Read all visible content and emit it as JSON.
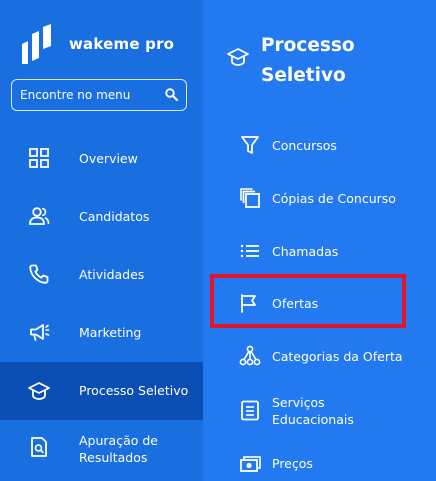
{
  "brand": {
    "name": "wakeme pro"
  },
  "search": {
    "placeholder": "Encontre no menu",
    "icon": "search-icon"
  },
  "sidebar": {
    "items": [
      {
        "label": "Overview",
        "icon": "grid-icon",
        "active": false
      },
      {
        "label": "Candidatos",
        "icon": "users-icon",
        "active": false
      },
      {
        "label": "Atividades",
        "icon": "phone-icon",
        "active": false
      },
      {
        "label": "Marketing",
        "icon": "megaphone-icon",
        "active": false
      },
      {
        "label": "Processo Seletivo",
        "icon": "graduation-cap-icon",
        "active": true
      },
      {
        "label": "Apuração de Resultados",
        "icon": "document-search-icon",
        "active": false
      }
    ]
  },
  "panel": {
    "title": "Processo Seletivo",
    "title_icon": "graduation-cap-icon",
    "items": [
      {
        "label": "Concursos",
        "icon": "filter-icon"
      },
      {
        "label": "Cópias de Concurso",
        "icon": "copy-icon"
      },
      {
        "label": "Chamadas",
        "icon": "list-icon"
      },
      {
        "label": "Ofertas",
        "icon": "flag-icon",
        "highlighted": true
      },
      {
        "label": "Categorias da Oferta",
        "icon": "hierarchy-icon"
      },
      {
        "label": "Serviços Educacionais",
        "icon": "document-list-icon"
      },
      {
        "label": "Preços",
        "icon": "money-icon"
      }
    ]
  },
  "colors": {
    "sidebar_bg": "#1a6fe0",
    "sidebar_active_bg": "#0c4fb4",
    "panel_bg": "#2379f0",
    "highlight_border": "#e3132b",
    "text": "#ffffff"
  }
}
